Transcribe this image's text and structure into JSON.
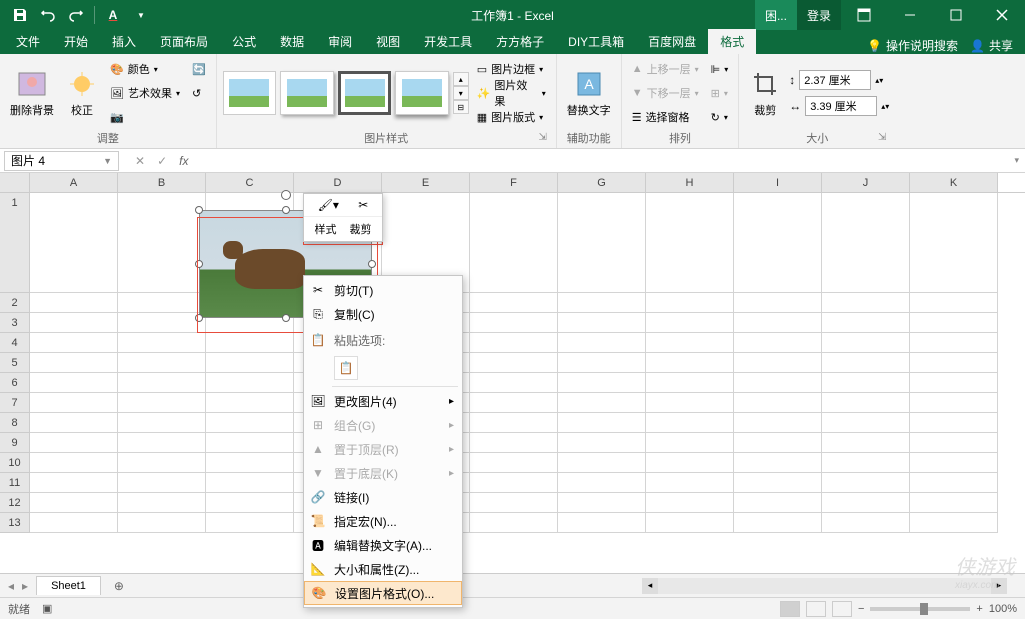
{
  "title": "工作簿1 - Excel",
  "login_label": "登录",
  "menu_tabs": [
    "文件",
    "开始",
    "插入",
    "页面布局",
    "公式",
    "数据",
    "审阅",
    "视图",
    "开发工具",
    "方方格子",
    "DIY工具箱",
    "百度网盘",
    "格式"
  ],
  "active_menu_tab": "格式",
  "tell_me": "操作说明搜索",
  "share": "共享",
  "ribbon": {
    "remove_bg": "删除背景",
    "corrections": "校正",
    "color": "颜色",
    "artistic": "艺术效果",
    "adjust_label": "调整",
    "styles_label": "图片样式",
    "border": "图片边框",
    "effects": "图片效果",
    "layout": "图片版式",
    "alt_text": "替换文字",
    "accessibility_label": "辅助功能",
    "bring_forward": "上移一层",
    "send_backward": "下移一层",
    "selection_pane": "选择窗格",
    "arrange_label": "排列",
    "crop": "裁剪",
    "height": "2.37 厘米",
    "width": "3.39 厘米",
    "size_label": "大小"
  },
  "name_box": "图片 4",
  "columns": [
    "A",
    "B",
    "C",
    "D",
    "E",
    "F",
    "G",
    "H",
    "I",
    "J",
    "K"
  ],
  "rows": [
    "1",
    "2",
    "3",
    "4",
    "5",
    "6",
    "7",
    "8",
    "9",
    "10",
    "11",
    "12",
    "13"
  ],
  "mini_toolbar": {
    "style": "样式",
    "crop": "裁剪"
  },
  "context_menu": {
    "cut": "剪切(T)",
    "copy": "复制(C)",
    "paste_options": "粘贴选项:",
    "change_picture": "更改图片(4)",
    "group": "组合(G)",
    "bring_to_front": "置于顶层(R)",
    "send_to_back": "置于底层(K)",
    "link": "链接(I)",
    "assign_macro": "指定宏(N)...",
    "edit_alt_text": "编辑替换文字(A)...",
    "size_properties": "大小和属性(Z)...",
    "format_picture": "设置图片格式(O)..."
  },
  "sheet": {
    "name": "Sheet1"
  },
  "status": {
    "ready": "就绪",
    "zoom": "100%"
  }
}
